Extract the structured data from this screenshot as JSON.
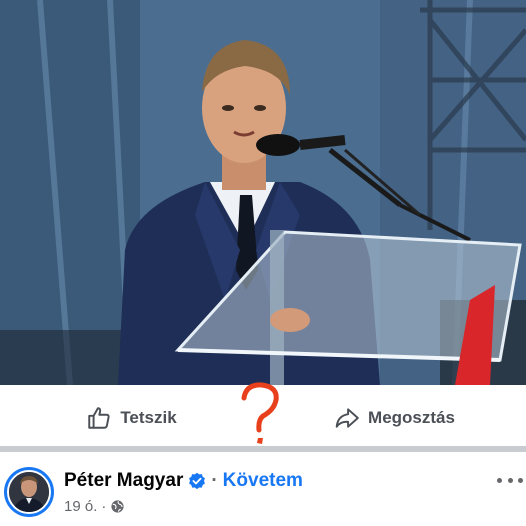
{
  "post": {
    "photo_alt": "Speaker at a glass podium with microphones",
    "actions": {
      "like_label": "Tetszik",
      "share_label": "Megosztás"
    },
    "overlay_mark": "?",
    "author": {
      "name": "Péter Magyar",
      "separator": "·",
      "follow_label": "Követem",
      "timestamp": "19 ó.",
      "meta_separator": "·"
    }
  },
  "colors": {
    "accent": "#1877f2",
    "text_primary": "#050505",
    "text_secondary": "#65676b",
    "action_text": "#4b4f56",
    "overlay_mark": "#e8401c"
  },
  "icons": {
    "like": "thumbs-up-icon",
    "share": "share-arrow-icon",
    "verified": "verified-badge-icon",
    "audience": "globe-icon",
    "more": "more-options-icon"
  }
}
